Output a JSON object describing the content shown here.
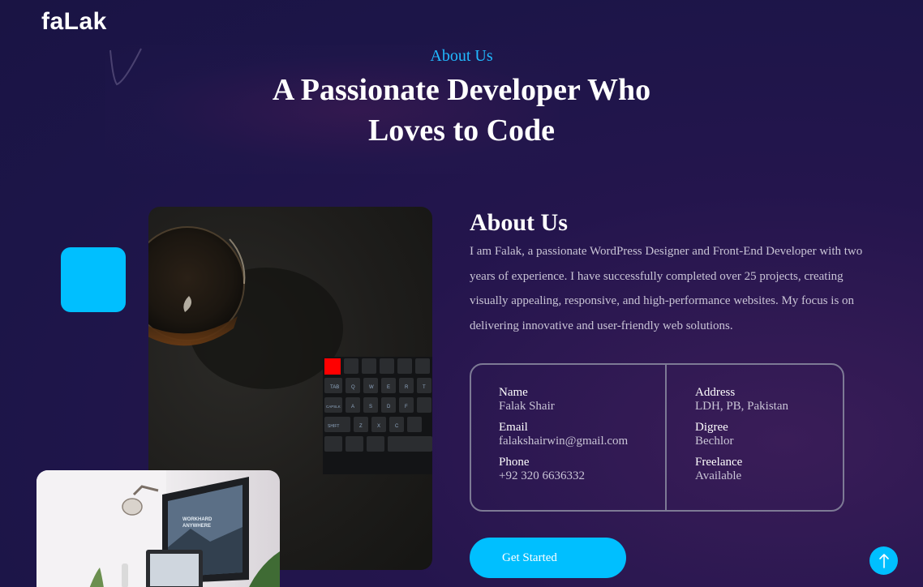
{
  "brand": {
    "logo": "faLak"
  },
  "hero": {
    "eyebrow": "About Us",
    "title_line1": "A Passionate Developer Who",
    "title_line2": "Loves to Code"
  },
  "about": {
    "heading": "About Us",
    "paragraph": "I am Falak, a passionate WordPress Designer and Front-End Developer with two years of experience. I have successfully completed over 25 projects, creating visually appealing, responsive, and high-performance websites. My focus is on delivering innovative and user-friendly web solutions."
  },
  "info": {
    "left": [
      {
        "label": "Name",
        "value": "Falak Shair"
      },
      {
        "label": "Email",
        "value": "falakshairwin@gmail.com"
      },
      {
        "label": "Phone",
        "value": "+92 320 6636332"
      }
    ],
    "right": [
      {
        "label": "Address",
        "value": "LDH, PB, Pakistan"
      },
      {
        "label": "Digree",
        "value": "Bechlor"
      },
      {
        "label": "Freelance",
        "value": "Available"
      }
    ]
  },
  "cta": {
    "label": "Get Started"
  },
  "keyboard": {
    "row2": [
      "TAB",
      "Q",
      "W",
      "E",
      "R",
      "T"
    ],
    "row3": [
      "CAPSLK",
      "A",
      "S",
      "D",
      "F"
    ],
    "row4": [
      "SHIFT",
      "Z",
      "X",
      "C"
    ]
  },
  "monitor": {
    "line1": "WORKHARD",
    "line2": "ANYWHERE"
  },
  "colors": {
    "accent": "#00bfff",
    "eyebrow": "#21b9ff",
    "background": "#1c1548",
    "card_border": "#7d7a95",
    "body_text": "#c9c4d6"
  },
  "icons": {
    "scroll_top": "arrow-up-icon"
  }
}
